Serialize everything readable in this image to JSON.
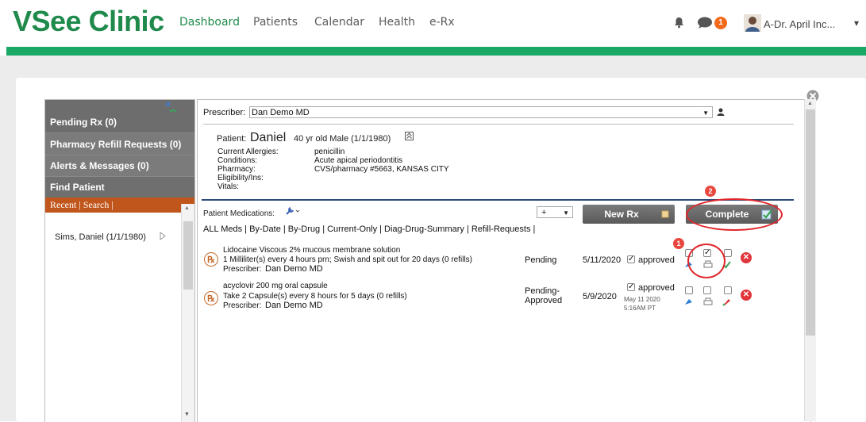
{
  "app": {
    "logo": "VSee Clinic"
  },
  "nav": {
    "items": [
      "Dashboard",
      "Patients",
      "Calendar",
      "Health",
      "e-Rx"
    ],
    "active": "Dashboard"
  },
  "header": {
    "message_count": "1",
    "user_name": "A-Dr. April Inc...",
    "dropdown_glyph": "▾"
  },
  "sidebar": {
    "collapse_glyph": "«",
    "items": [
      {
        "label": "Pending Rx (0)"
      },
      {
        "label": "Pharmacy Refill Requests (0)"
      },
      {
        "label": "Alerts & Messages (0)"
      },
      {
        "label": "Find Patient"
      }
    ],
    "recent_search": "Recent | Search |",
    "patient_entry": "Sims, Daniel  (1/1/1980)"
  },
  "prescriber": {
    "label": "Prescriber:",
    "value": "Dan Demo MD"
  },
  "patient": {
    "label": "Patient:",
    "name": "Daniel",
    "demographics": "40 yr old Male (1/1/1980)",
    "fields": [
      {
        "label": "Current Allergies:",
        "value": "penicillin"
      },
      {
        "label": "Conditions:",
        "value": "Acute apical periodontitis"
      },
      {
        "label": "Pharmacy:",
        "value": "CVS/pharmacy #5663, KANSAS CITY"
      },
      {
        "label": "Eligibility/Ins:",
        "value": ""
      },
      {
        "label": "Vitals:",
        "value": ""
      }
    ]
  },
  "medications": {
    "label": "Patient Medications:",
    "add_select": "+",
    "new_rx_label": "New Rx",
    "complete_label": "Complete",
    "filters": "ALL Meds | By-Date | By-Drug | Current-Only | Diag-Drug-Summary | Refill-Requests |",
    "rows": [
      {
        "drug": "Lidocaine Viscous 2% mucous membrane solution",
        "sig": "1 Milliliter(s) every 4 hours prn; Swish and spit out for 20 days (0 refills)",
        "prescriber_label": "Prescriber:",
        "prescriber": "Dan Demo MD",
        "status": "Pending",
        "date": "5/11/2020",
        "approved": "approved",
        "approved_meta": ""
      },
      {
        "drug": "acyclovir 200 mg oral capsule",
        "sig": "Take 2 Capsule(s) every 8 hours for 5 days (0 refills)",
        "prescriber_label": "Prescriber:",
        "prescriber": "Dan Demo MD",
        "status": "Pending-Approved",
        "date": "5/9/2020",
        "approved": "approved",
        "approved_meta": "May 11 2020 5:16AM PT"
      }
    ]
  },
  "annotations": {
    "step1": "1",
    "step2": "2"
  },
  "colors": {
    "brand_green": "#1f8a4c",
    "bar_green": "#1aa865",
    "accent_red": "#e0262a",
    "sidebar_orange": "#c0561b"
  }
}
